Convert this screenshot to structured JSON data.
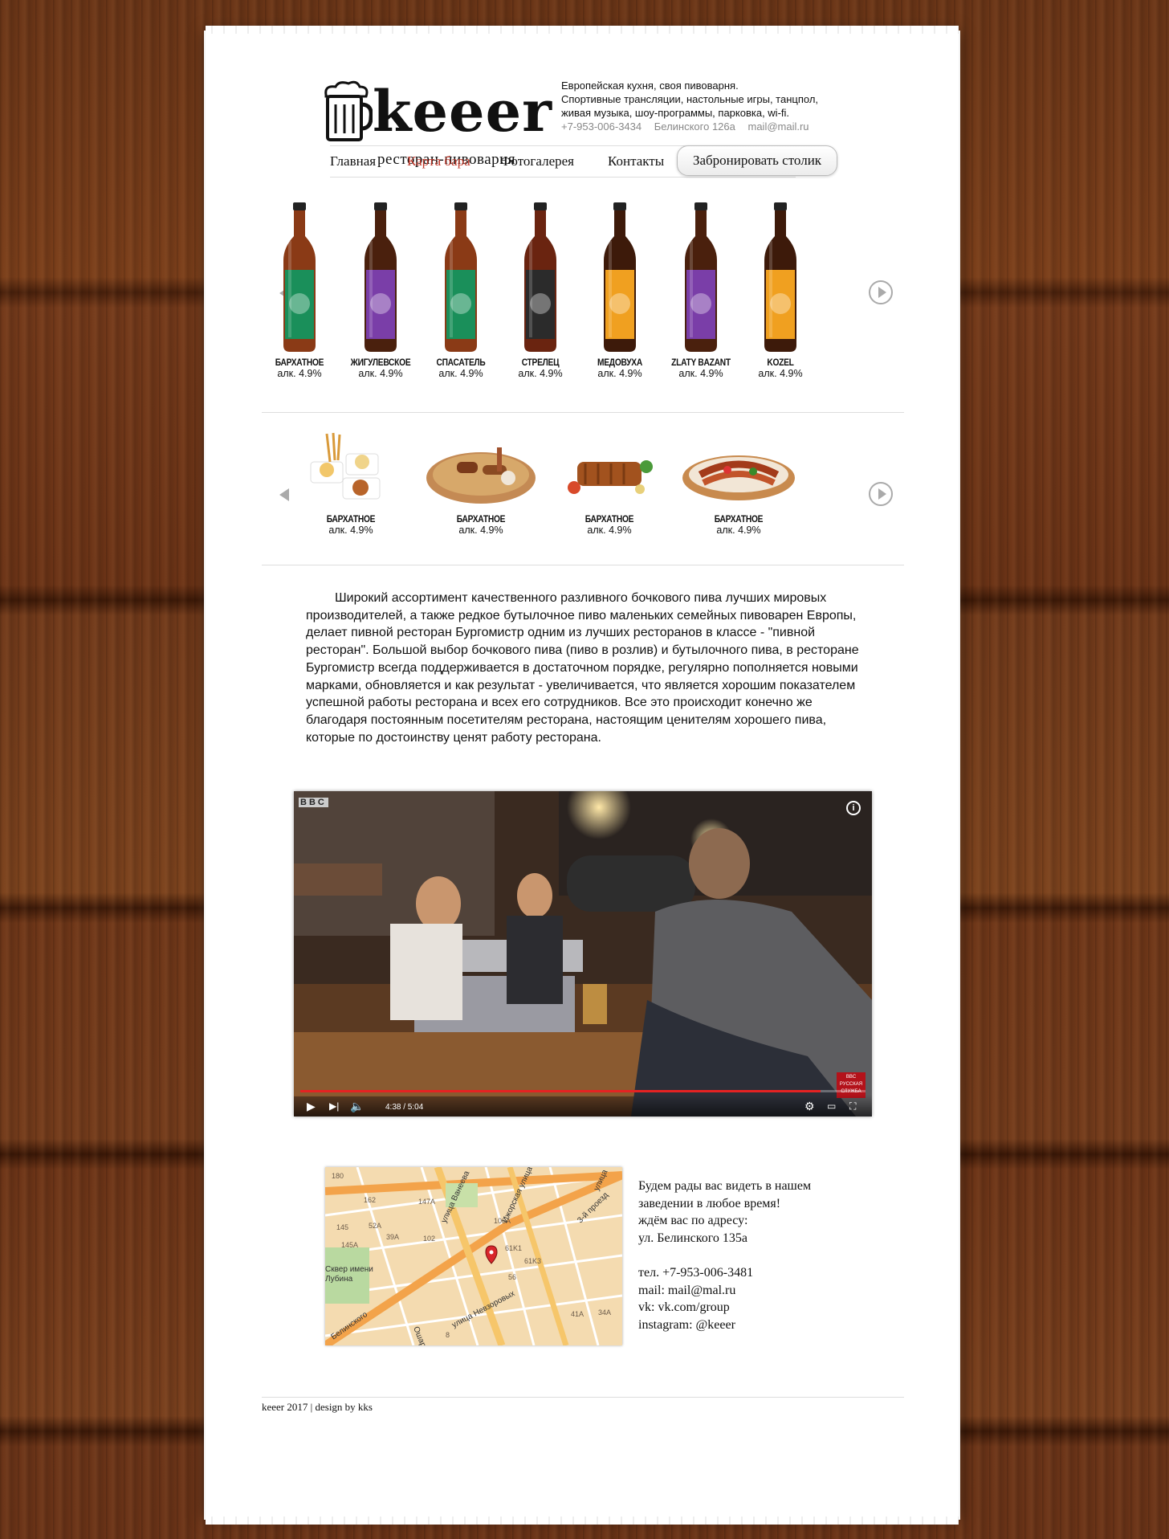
{
  "brand": {
    "name": "keeer",
    "subtitle": "ресторан-пивоварня"
  },
  "tagline": [
    "Европейская кухня, своя пивоварня.",
    "Спортивные трансляции, настольные игры, танцпол,",
    "живая музыка, шоу-программы, парковка, wi-fi."
  ],
  "contacts": {
    "phone": "+7-953-006-3434",
    "address": "Белинского 126а",
    "email": "mail@mail.ru"
  },
  "nav": {
    "items": [
      "Главная",
      "Карта бара",
      "Фотогалерея",
      "Контакты"
    ],
    "active": "Карта бара",
    "book_button": "Забронировать столик"
  },
  "beers": [
    {
      "name": "БАРХАТНОЕ",
      "alc": "алк. 4.9%"
    },
    {
      "name": "ЖИГУЛЕВСКОЕ",
      "alc": "алк. 4.9%"
    },
    {
      "name": "СПАСАТЕЛЬ",
      "alc": "алк. 4.9%"
    },
    {
      "name": "СТРЕЛЕЦ",
      "alc": "алк. 4.9%"
    },
    {
      "name": "МЕДОВУХА",
      "alc": "алк. 4.9%"
    },
    {
      "name": "ZLATY BAZANT",
      "alc": "алк. 4.9%"
    },
    {
      "name": "KOZEL",
      "alc": "алк. 4.9%"
    }
  ],
  "snacks": [
    {
      "name": "БАРХАТНОЕ",
      "alc": "алк. 4.9%"
    },
    {
      "name": "БАРХАТНОЕ",
      "alc": "алк. 4.9%"
    },
    {
      "name": "БАРХАТНОЕ",
      "alc": "алк. 4.9%"
    },
    {
      "name": "БАРХАТНОЕ",
      "alc": "алк. 4.9%"
    }
  ],
  "description": "Широкий ассортимент качественного разливного бочкового пива лучших мировых производителей, а также редкое бутылочное пиво маленьких семейных пивоварен Европы, делает пивной ресторан Бургомистр одним из лучших ресторанов в классе - \"пивной ресторан\". Большой выбор бочкового пива (пиво в розлив) и бутылочного пива, в ресторане Бургомистр всегда поддерживается в достаточном порядке, регулярно пополняется новыми марками, обновляется и как результат - увеличивается, что является хорошим показателем успешной работы ресторана и всех его сотрудников. Все это происходит конечно же благодаря постоянным посетителям ресторана, настоящим ценителям хорошего пива, которые по достоинству ценят работу ресторана.",
  "video": {
    "channel_logo": "BBC",
    "badge": "BBC РУССКАЯ СЛУЖБА",
    "time": "4:38 / 5:04",
    "progress": 0.92
  },
  "map": {
    "streets": [
      "улица Ванеева",
      "улица Невзоровых",
      "Ошарская улица",
      "Ижорская улица",
      "3-й проезд",
      "Белинского",
      "улица"
    ],
    "house_numbers": [
      "180",
      "162",
      "147A",
      "145",
      "52A",
      "106A",
      "39A",
      "102",
      "61K1",
      "61K3",
      "56",
      "34A",
      "41A",
      "145A",
      "8"
    ],
    "park_label": "Сквер имени Лубина"
  },
  "address_block": [
    "Будем рады вас видеть в нашем",
    "заведении в любое время!",
    "ждём вас по адресу:",
    "ул. Белинского 135а",
    "",
    "тел. +7-953-006-3481",
    "mail: mail@mal.ru",
    "vk: vk.com/group",
    "instagram: @keeer"
  ],
  "footer": "keeer 2017 | design by kks",
  "colors": {
    "accent": "#c0392b",
    "wood": "#6a3317",
    "paper": "#ffffff"
  }
}
